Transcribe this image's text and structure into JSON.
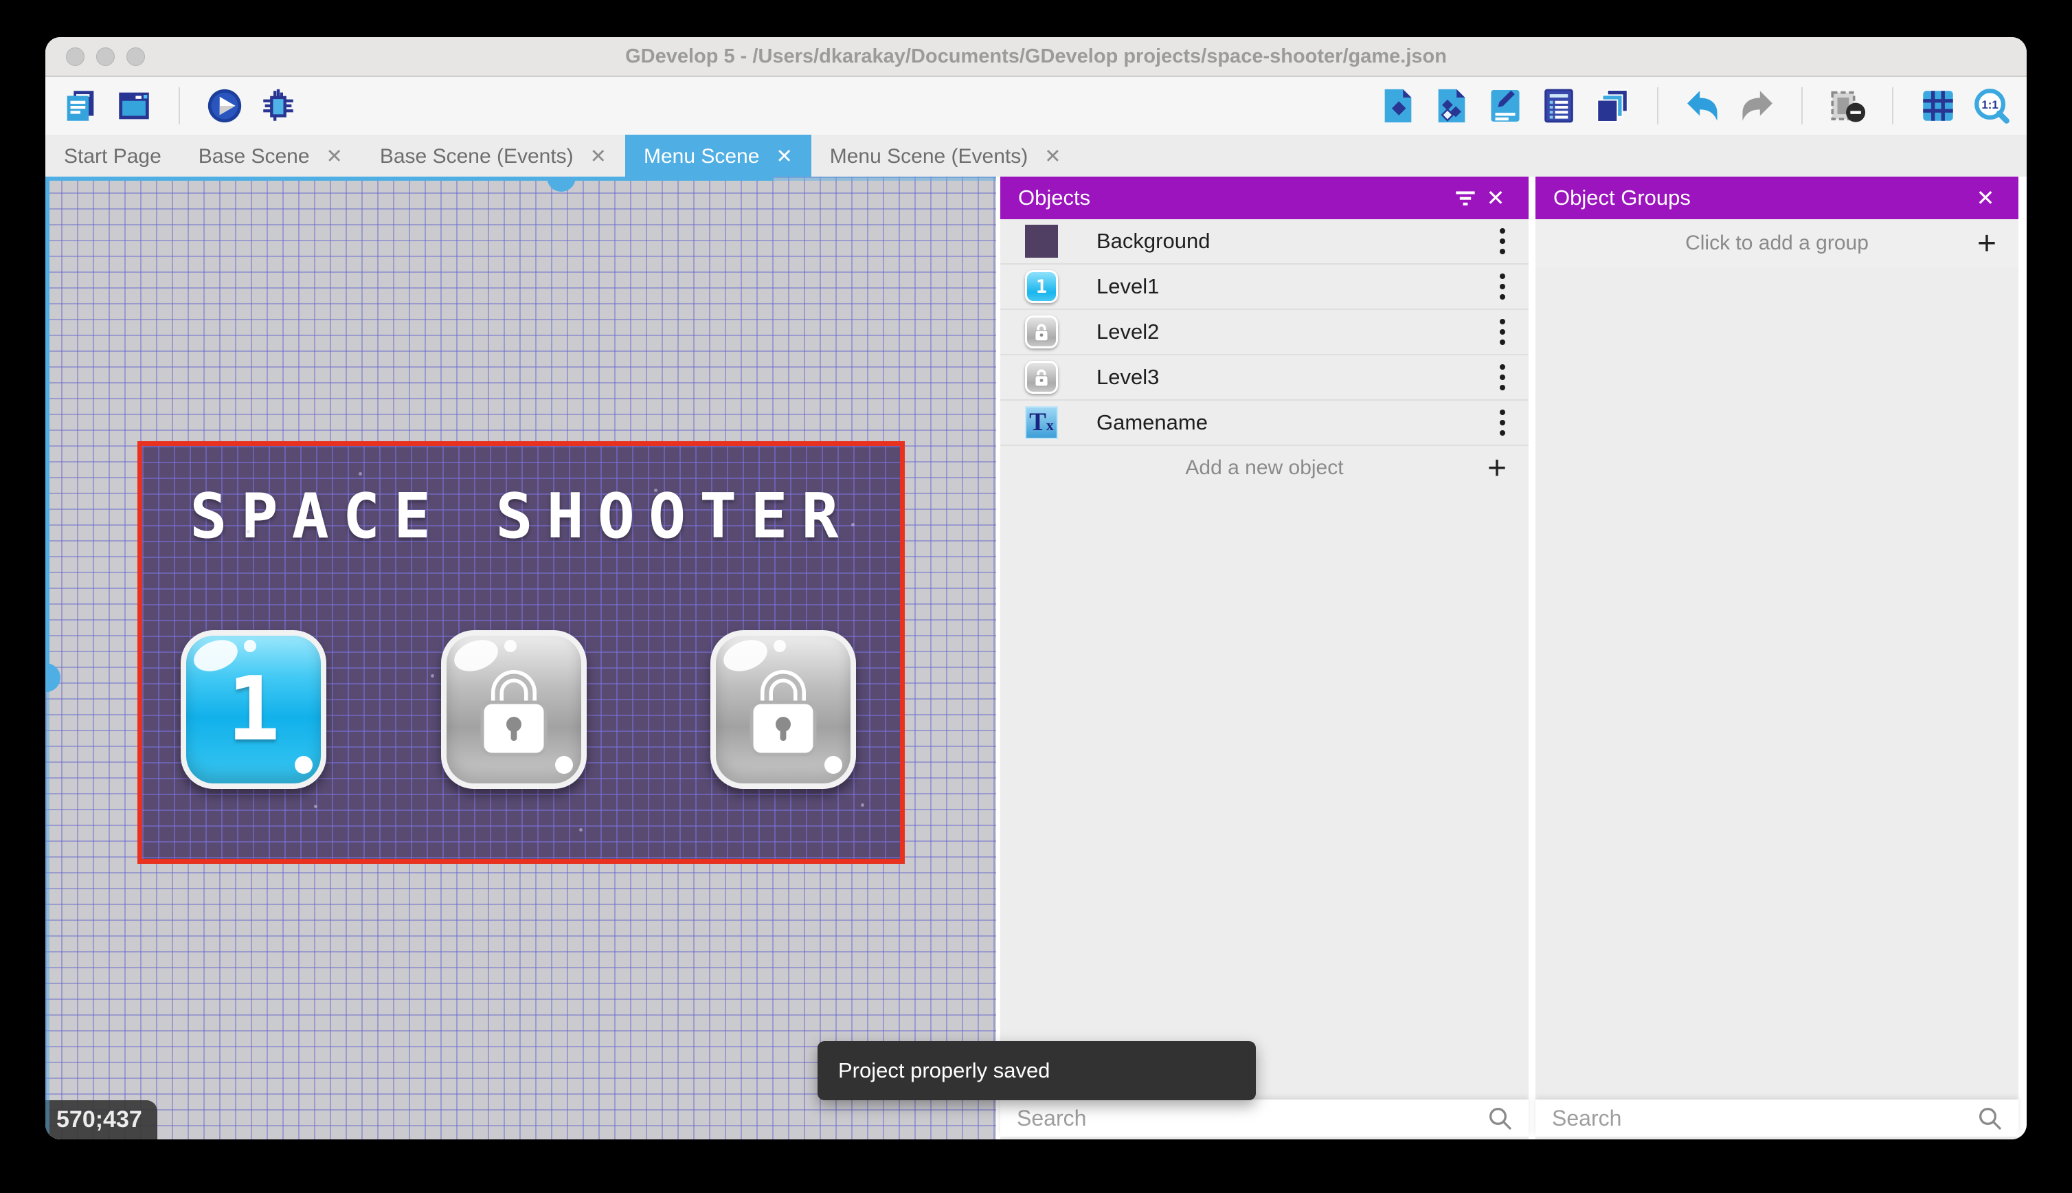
{
  "window": {
    "title": "GDevelop 5 - /Users/dkarakay/Documents/GDevelop projects/space-shooter/game.json"
  },
  "toolbar": {
    "left_icons": [
      "project-manager-icon",
      "scene-window-icon",
      "play-icon",
      "debug-icon"
    ],
    "right_icons": [
      "objects-panel-icon",
      "object-groups-icon",
      "properties-icon",
      "instances-list-icon",
      "layers-icon",
      "undo-icon",
      "redo-icon",
      "window-mask-icon",
      "grid-icon",
      "zoom-1-1-icon"
    ],
    "zoom_ratio_label": "1:1"
  },
  "tabs": [
    {
      "label": "Start Page",
      "active": false,
      "closable": false
    },
    {
      "label": "Base Scene",
      "active": false,
      "closable": true
    },
    {
      "label": "Base Scene (Events)",
      "active": false,
      "closable": true
    },
    {
      "label": "Menu Scene",
      "active": true,
      "closable": true
    },
    {
      "label": "Menu Scene (Events)",
      "active": false,
      "closable": true
    }
  ],
  "scene": {
    "title": "SPACE SHOOTER",
    "buttons": [
      {
        "label": "1",
        "locked": false
      },
      {
        "label": "",
        "locked": true
      },
      {
        "label": "",
        "locked": true
      }
    ],
    "coordinates": "570;437"
  },
  "objects_panel": {
    "title": "Objects",
    "items": [
      {
        "name": "Background",
        "icon": "background-thumbnail"
      },
      {
        "name": "Level1",
        "icon": "level1-button-thumbnail",
        "badge": "1"
      },
      {
        "name": "Level2",
        "icon": "locked-button-thumbnail"
      },
      {
        "name": "Level3",
        "icon": "locked-button-thumbnail"
      },
      {
        "name": "Gamename",
        "icon": "text-object-thumbnail",
        "badge_main": "T",
        "badge_sub": "x"
      }
    ],
    "add_label": "Add a new object",
    "search_placeholder": "Search"
  },
  "object_groups_panel": {
    "title": "Object Groups",
    "add_label": "Click to add a group",
    "search_placeholder": "Search"
  },
  "toast": {
    "message": "Project properly saved"
  },
  "ui": {
    "close_glyph": "✕",
    "plus_glyph": "+"
  },
  "colors": {
    "accent_purple": "#9b14be",
    "accent_blue": "#4faee3",
    "selection_red": "#e8311f",
    "scene_background": "#584a71",
    "toast_background": "#323232"
  }
}
